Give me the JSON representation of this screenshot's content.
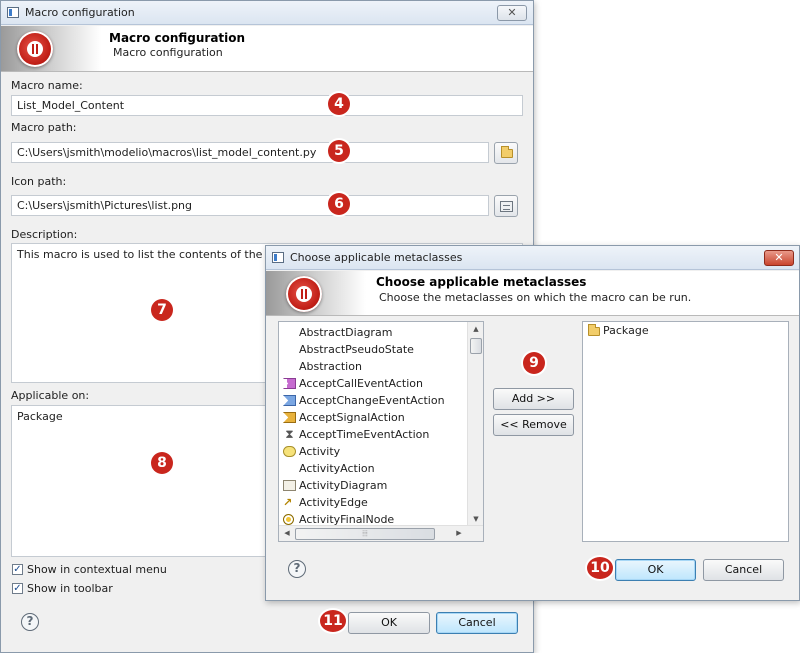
{
  "macro_dialog": {
    "title": "Macro configuration",
    "close_label": "✕",
    "banner_title": "Macro configuration",
    "banner_subtitle": "Macro configuration",
    "name_label": "Macro name:",
    "name_value": "List_Model_Content",
    "path_label": "Macro path:",
    "path_value": "C:\\Users\\jsmith\\modelio\\macros\\list_model_content.py",
    "icon_label": "Icon path:",
    "icon_value": "C:\\Users\\jsmith\\Pictures\\list.png",
    "description_label": "Description:",
    "description_value": "This macro is used to list the contents of the model",
    "applicable_label": "Applicable on:",
    "applicable_value": "Package",
    "contextual_menu_label": "Show in contextual menu",
    "contextual_menu_checked": true,
    "toolbar_label": "Show in toolbar",
    "toolbar_checked": true,
    "ok_label": "OK",
    "cancel_label": "Cancel",
    "help_label": "?"
  },
  "metaclass_dialog": {
    "title": "Choose applicable metaclasses",
    "close_label": "✕",
    "banner_title": "Choose applicable metaclasses",
    "banner_subtitle": "Choose the metaclasses on which the macro can be run.",
    "available": [
      {
        "label": "AbstractDiagram",
        "icon": "none"
      },
      {
        "label": "AbstractPseudoState",
        "icon": "none"
      },
      {
        "label": "Abstraction",
        "icon": "none"
      },
      {
        "label": "AcceptCallEventAction",
        "icon": "accept-call-event-icon"
      },
      {
        "label": "AcceptChangeEventAction",
        "icon": "accept-change-event-icon"
      },
      {
        "label": "AcceptSignalAction",
        "icon": "accept-signal-icon"
      },
      {
        "label": "AcceptTimeEventAction",
        "icon": "hourglass-icon"
      },
      {
        "label": "Activity",
        "icon": "activity-icon"
      },
      {
        "label": "ActivityAction",
        "icon": "none"
      },
      {
        "label": "ActivityDiagram",
        "icon": "activity-diagram-icon"
      },
      {
        "label": "ActivityEdge",
        "icon": "activity-edge-icon"
      },
      {
        "label": "ActivityFinalNode",
        "icon": "final-node-icon"
      }
    ],
    "add_label": "Add >>",
    "remove_label": "<< Remove",
    "selected": [
      {
        "label": "Package",
        "icon": "package-folder-icon"
      }
    ],
    "ok_label": "OK",
    "cancel_label": "Cancel",
    "help_label": "?"
  },
  "callouts": [
    "4",
    "5",
    "6",
    "7",
    "8",
    "9",
    "10",
    "11"
  ],
  "colors": {
    "callout_red": "#c9261d",
    "title_gradient_top": "#eef3f9",
    "default_button_blue": "#bee6fd"
  }
}
